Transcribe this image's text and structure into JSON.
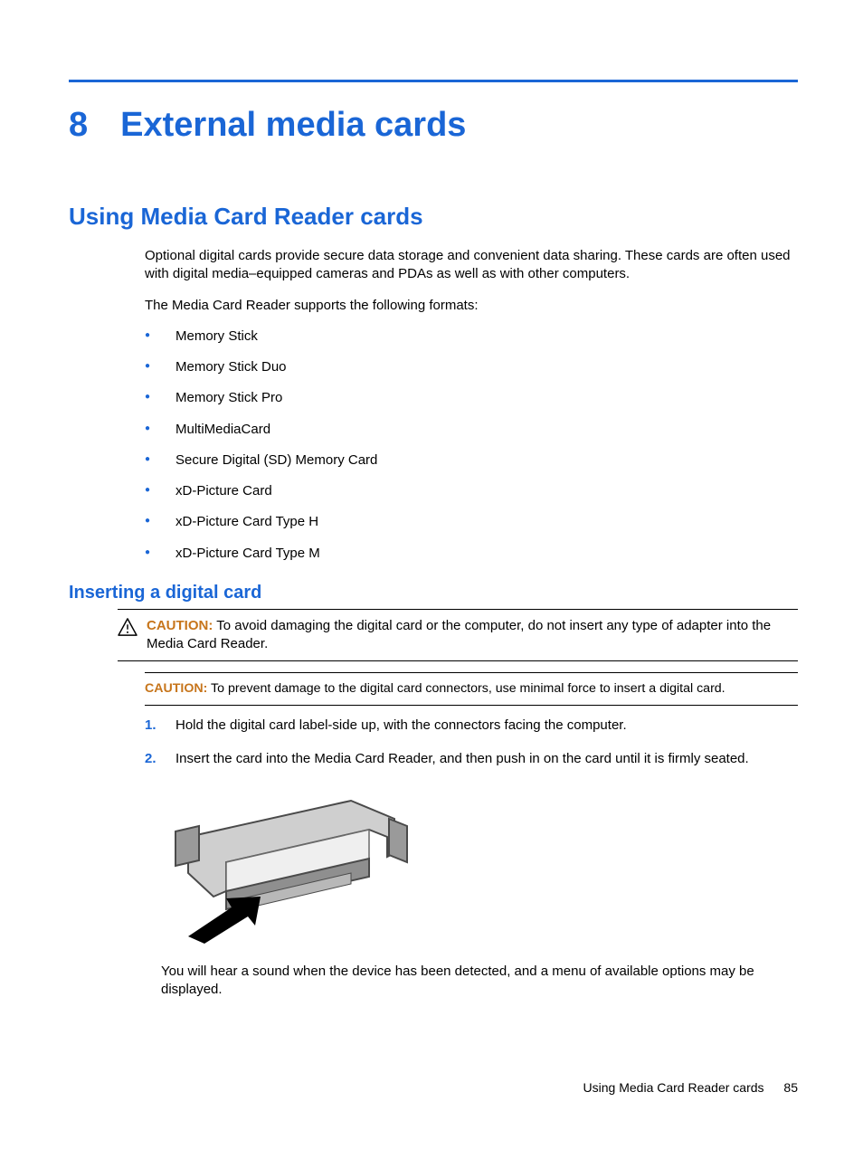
{
  "chapter": {
    "number": "8",
    "title": "External media cards"
  },
  "section": {
    "title": "Using Media Card Reader cards"
  },
  "intro": {
    "p1": "Optional digital cards provide secure data storage and convenient data sharing. These cards are often used with digital media–equipped cameras and PDAs as well as with other computers.",
    "p2": "The Media Card Reader supports the following formats:"
  },
  "formats": [
    "Memory Stick",
    "Memory Stick Duo",
    "Memory Stick Pro",
    "MultiMediaCard",
    "Secure Digital (SD) Memory Card",
    "xD-Picture Card",
    "xD-Picture Card Type H",
    "xD-Picture Card Type M"
  ],
  "subsection": {
    "title": "Inserting a digital card"
  },
  "caution1": {
    "label": "CAUTION:",
    "text": "To avoid damaging the digital card or the computer, do not insert any type of adapter into the Media Card Reader."
  },
  "caution2": {
    "label": "CAUTION:",
    "text": "To prevent damage to the digital card connectors, use minimal force to insert a digital card."
  },
  "steps": [
    {
      "n": "1.",
      "t": "Hold the digital card label-side up, with the connectors facing the computer."
    },
    {
      "n": "2.",
      "t": "Insert the card into the Media Card Reader, and then push in on the card until it is firmly seated."
    }
  ],
  "followup": "You will hear a sound when the device has been detected, and a menu of available options may be displayed.",
  "footer": {
    "title": "Using Media Card Reader cards",
    "page": "85"
  }
}
